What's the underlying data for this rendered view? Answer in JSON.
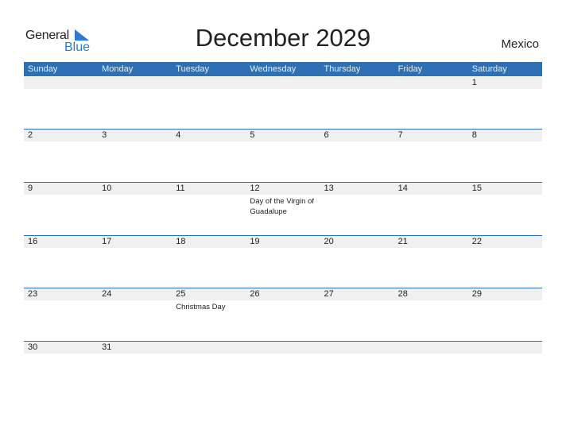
{
  "logo": {
    "word1": "General",
    "word2": "Blue",
    "icon": "triangle-flag-icon"
  },
  "title": "December 2029",
  "country": "Mexico",
  "colors": {
    "accent": "#2e70b3",
    "day_band": "#f0f0f0",
    "logo_blue": "#2a7bd4"
  },
  "days_of_week": [
    "Sunday",
    "Monday",
    "Tuesday",
    "Wednesday",
    "Thursday",
    "Friday",
    "Saturday"
  ],
  "weeks": [
    [
      {
        "day": ""
      },
      {
        "day": ""
      },
      {
        "day": ""
      },
      {
        "day": ""
      },
      {
        "day": ""
      },
      {
        "day": ""
      },
      {
        "day": "1"
      }
    ],
    [
      {
        "day": "2"
      },
      {
        "day": "3"
      },
      {
        "day": "4"
      },
      {
        "day": "5"
      },
      {
        "day": "6"
      },
      {
        "day": "7"
      },
      {
        "day": "8"
      }
    ],
    [
      {
        "day": "9"
      },
      {
        "day": "10"
      },
      {
        "day": "11"
      },
      {
        "day": "12",
        "event": "Day of the Virgin of Guadalupe"
      },
      {
        "day": "13"
      },
      {
        "day": "14"
      },
      {
        "day": "15"
      }
    ],
    [
      {
        "day": "16"
      },
      {
        "day": "17"
      },
      {
        "day": "18"
      },
      {
        "day": "19"
      },
      {
        "day": "20"
      },
      {
        "day": "21"
      },
      {
        "day": "22"
      }
    ],
    [
      {
        "day": "23"
      },
      {
        "day": "24"
      },
      {
        "day": "25",
        "event": "Christmas Day"
      },
      {
        "day": "26"
      },
      {
        "day": "27"
      },
      {
        "day": "28"
      },
      {
        "day": "29"
      }
    ],
    [
      {
        "day": "30"
      },
      {
        "day": "31"
      },
      {
        "day": ""
      },
      {
        "day": ""
      },
      {
        "day": ""
      },
      {
        "day": ""
      },
      {
        "day": ""
      }
    ]
  ]
}
